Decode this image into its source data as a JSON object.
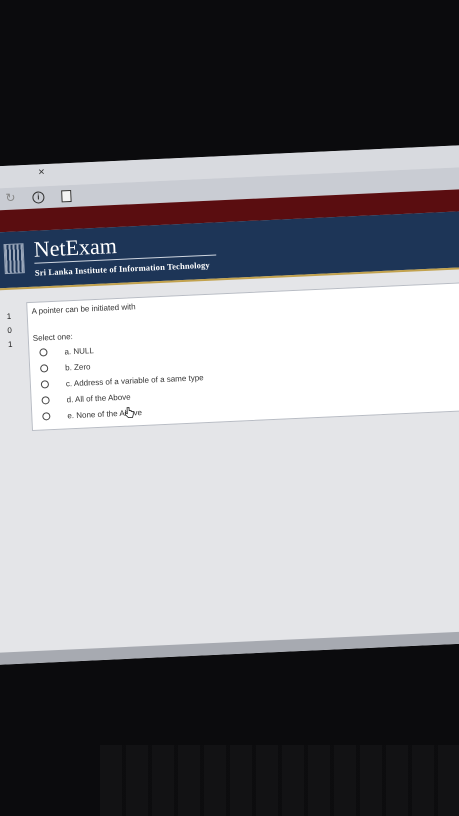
{
  "browser": {
    "tab_close": "×",
    "reload_icon": "reload-icon",
    "info_icon": "info-icon",
    "page_icon": "page-icon"
  },
  "header": {
    "brand": "NetExam",
    "subtitle": "Sri Lanka Institute of Information Technology",
    "logo_icon": "sliit-logo-icon",
    "colors": {
      "header_bg": "#1d3557",
      "band": "#5a0d10",
      "accent": "#c2a24e"
    }
  },
  "side_marks": [
    "1",
    "0",
    "1"
  ],
  "question": {
    "text": "A pointer can be initiated with",
    "prompt": "Select one:",
    "options": [
      {
        "label": "a. NULL",
        "selected": false
      },
      {
        "label": "b. Zero",
        "selected": false
      },
      {
        "label": "c. Address of a variable of a same type",
        "selected": false
      },
      {
        "label": "d. All of the Above",
        "selected": false
      },
      {
        "label": "e. None of the Above",
        "selected": false
      }
    ]
  }
}
